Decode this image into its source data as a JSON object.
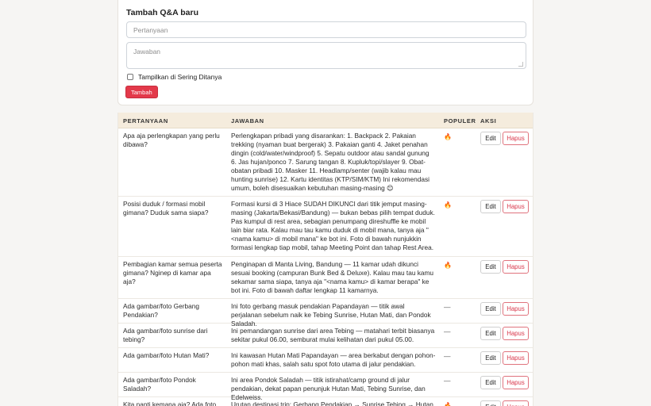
{
  "form": {
    "title": "Tambah Q&A baru",
    "question_placeholder": "Pertanyaan",
    "answer_placeholder": "Jawaban",
    "checkbox_label": "Tampilkan di Sering Ditanya",
    "add_label": "Tambah"
  },
  "table": {
    "headers": {
      "question": "PERTANYAAN",
      "answer": "JAWABAN",
      "popular": "POPULER",
      "actions": "AKSI"
    },
    "edit_label": "Edit",
    "delete_label": "Hapus",
    "popular_icon": "🔥",
    "not_popular": "—",
    "rows": [
      {
        "question": "Apa aja perlengkapan yang perlu dibawa?",
        "answer": "Perlengkapan pribadi yang disarankan: 1. Backpack 2. Pakaian trekking (nyaman buat bergerak) 3. Pakaian ganti 4. Jaket penahan dingin (cold/water/windproof) 5. Sepatu outdoor atau sandal gunung 6. Jas hujan/ponco 7. Sarung tangan 8. Kupluk/topi/slayer 9. Obat-obatan pribadi 10. Masker 11. Headlamp/senter (wajib kalau mau hunting sunrise) 12. Kartu identitas (KTP/SIM/KTM) Ini rekomendasi umum, boleh disesuaikan kebutuhan masing-masing 😊",
        "popular": true
      },
      {
        "question": "Posisi duduk / formasi mobil gimana? Duduk sama siapa?",
        "answer": "Formasi kursi di 3 Hiace SUDAH DIKUNCI dari titik jemput masing-masing (Jakarta/Bekasi/Bandung) — bukan bebas pilih tempat duduk. Pas kumpul di rest area, sebagian penumpang direshuffle ke mobil lain biar rata. Kalau mau tau kamu duduk di mobil mana, tanya aja \"<nama kamu> di mobil mana\" ke bot ini. Foto di bawah nunjukkin formasi lengkap tiap mobil, tahap Meeting Point dan tahap Rest Area.",
        "popular": true
      },
      {
        "question": "Pembagian kamar semua peserta gimana? Nginep di kamar apa aja?",
        "answer": "Penginapan di Manta Living, Bandung — 11 kamar udah dikunci sesuai booking (campuran Bunk Bed & Deluxe). Kalau mau tau kamu sekamar sama siapa, tanya aja \"<nama kamu> di kamar berapa\" ke bot ini. Foto di bawah daftar lengkap 11 kamarnya.",
        "popular": true
      },
      {
        "question": "Ada gambar/foto Gerbang Pendakian?",
        "answer": "Ini foto gerbang masuk pendakian Papandayan — titik awal perjalanan sebelum naik ke Tebing Sunrise, Hutan Mati, dan Pondok Saladah.",
        "popular": false
      },
      {
        "question": "Ada gambar/foto sunrise dari tebing?",
        "answer": "Ini pemandangan sunrise dari area Tebing — matahari terbit biasanya sekitar pukul 06.00, semburat mulai kelihatan dari pukul 05.00.",
        "popular": false
      },
      {
        "question": "Ada gambar/foto Hutan Mati?",
        "answer": "Ini kawasan Hutan Mati Papandayan — area berkabut dengan pohon-pohon mati khas, salah satu spot foto utama di jalur pendakian.",
        "popular": false
      },
      {
        "question": "Ada gambar/foto Pondok Saladah?",
        "answer": "Ini area Pondok Saladah — titik istirahat/camp ground di jalur pendakian, dekat papan penunjuk Hutan Mati, Tebing Sunrise, dan Edelweiss.",
        "popular": false
      },
      {
        "question": "Kita nanti kemana aja? Ada foto",
        "answer": "Urutan destinasi trip: Gerbang Pendakian → Sunrise Tebing → Hutan",
        "popular": true
      }
    ]
  }
}
